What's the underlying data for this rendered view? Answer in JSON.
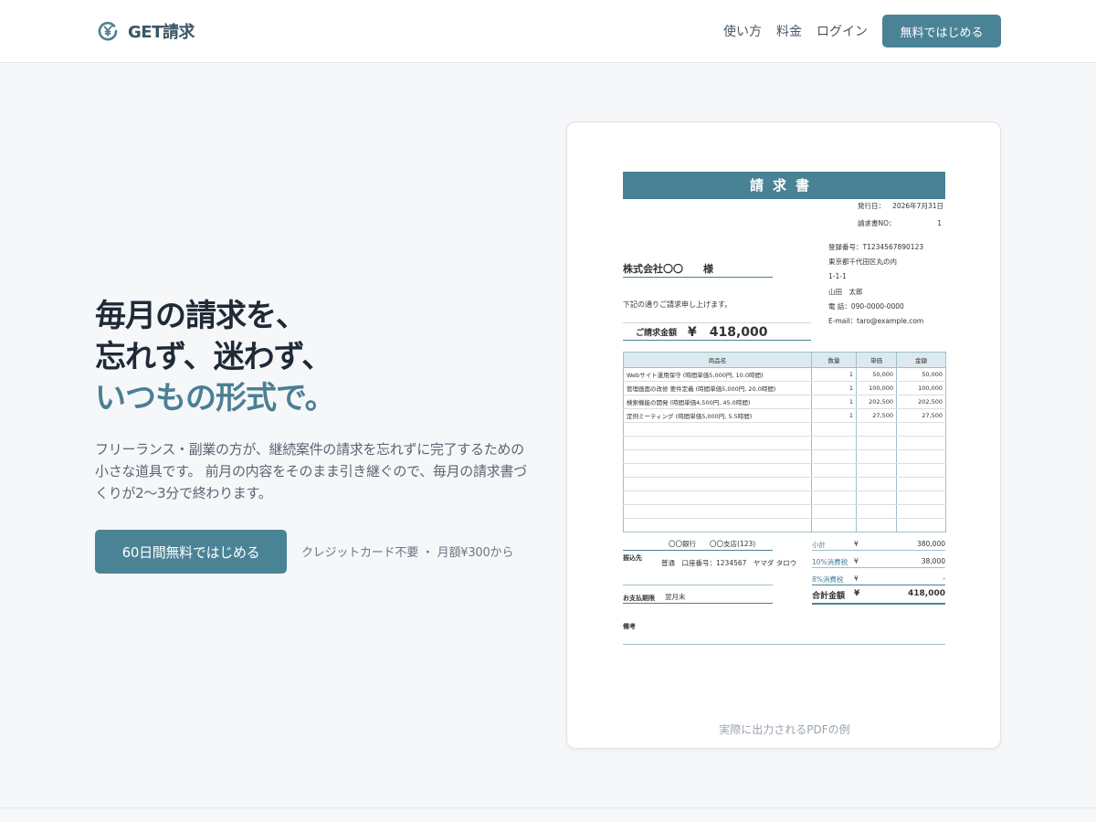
{
  "header": {
    "logo_text": "GET請求",
    "nav": [
      "使い方",
      "料金",
      "ログイン"
    ],
    "cta": "無料ではじめる"
  },
  "hero": {
    "title_lines": [
      "毎月の請求を、",
      "忘れず、迷わず、"
    ],
    "title_accent": "いつもの形式で。",
    "subtitle": "フリーランス・副業の方が、継続案件の請求を忘れずに完了するための小さな道具です。 前月の内容をそのまま引き継ぐので、毎月の請求書づくりが2〜3分で終わります。",
    "cta": "60日間無料ではじめる",
    "note": "クレジットカード不要 ・ 月額¥300から"
  },
  "preview": {
    "caption": "実際に出力されるPDFの例",
    "invoice": {
      "title": "請求書",
      "issue_label": "発行日：",
      "issue_date": "2026年7月31日",
      "no_label": "請求書NO：",
      "no_value": "1",
      "issuer": [
        "登録番号：T1234567890123",
        "東京都千代田区丸の内",
        "1-1-1",
        "山田　太郎",
        "電 話：090-0000-0000",
        "E-mail：taro@example.com"
      ],
      "client": "株式会社〇〇",
      "client_suffix": "様",
      "intro": "下記の通りご請求申し上げます。",
      "amount_label": "ご請求金額",
      "amount_value": "¥　418,000",
      "headers": [
        "商品名",
        "数量",
        "単価",
        "金額"
      ],
      "items": [
        [
          "Webサイト運用保守 (時間単価5,000円, 10.0時間)",
          "1",
          "50,000",
          "50,000"
        ],
        [
          "管理画面の改修 要件定義 (時間単価5,000円, 20.0時間)",
          "1",
          "100,000",
          "100,000"
        ],
        [
          "検索機能の開発 (時間単価4,500円, 45.0時間)",
          "1",
          "202,500",
          "202,500"
        ],
        [
          "定例ミーティング (時間単価5,000円, 5.5時間)",
          "1",
          "27,500",
          "27,500"
        ]
      ],
      "empty_rows": 8,
      "bank": "〇〇銀行　　〇〇支店(123)",
      "bank_label": "振込先",
      "account": "普通　口座番号：1234567　ヤマダ タロウ",
      "due_label": "お支払期限",
      "due_value": "翌月末",
      "notes_label": "備考",
      "totals": [
        {
          "label": "小計",
          "yen": "¥",
          "value": "380,000"
        },
        {
          "label": "10%消費税",
          "yen": "¥",
          "value": "38,000"
        },
        {
          "label": "8%消費税",
          "yen": "¥",
          "value": "-"
        }
      ],
      "grand_label": "合計金額",
      "grand_yen": "¥",
      "grand_value": "418,000"
    }
  },
  "colors": {
    "accent": "#4b8396",
    "title_accent": "#4b7f93",
    "background": "#f5f7f9"
  }
}
